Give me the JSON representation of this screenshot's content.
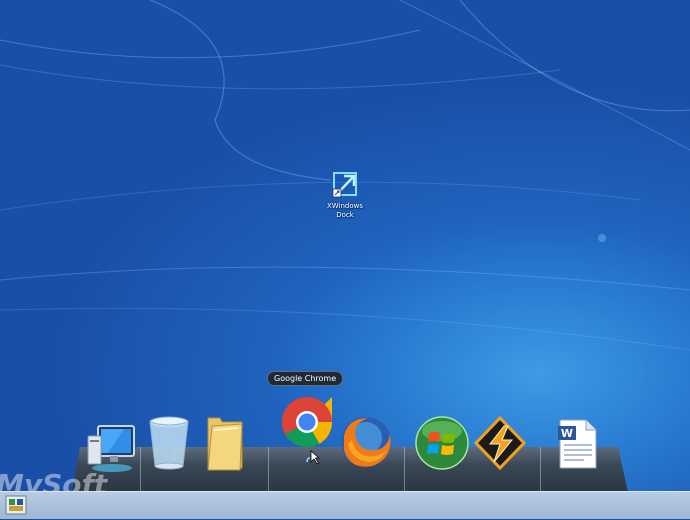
{
  "desktop": {
    "shortcut": {
      "label": "XWindows Dock",
      "icon": "xwindows-dock-shortcut-icon"
    }
  },
  "dock": {
    "tooltip": "Google Chrome",
    "items": [
      {
        "name": "computer",
        "icon": "computer-monitor-icon"
      },
      {
        "name": "recycle-bin",
        "icon": "recycle-bin-icon"
      },
      {
        "name": "folder",
        "icon": "folder-icon"
      },
      {
        "name": "google-chrome",
        "icon": "chrome-icon"
      },
      {
        "name": "firefox",
        "icon": "firefox-icon"
      },
      {
        "name": "windows",
        "icon": "windows-logo-icon"
      },
      {
        "name": "winamp",
        "icon": "winamp-icon"
      },
      {
        "name": "word-document",
        "icon": "word-document-icon"
      }
    ]
  },
  "watermark": "MySoft",
  "colors": {
    "desktop_bg": "#1f63be",
    "dock": "#3a4856",
    "taskbar": "#a9c0db"
  }
}
